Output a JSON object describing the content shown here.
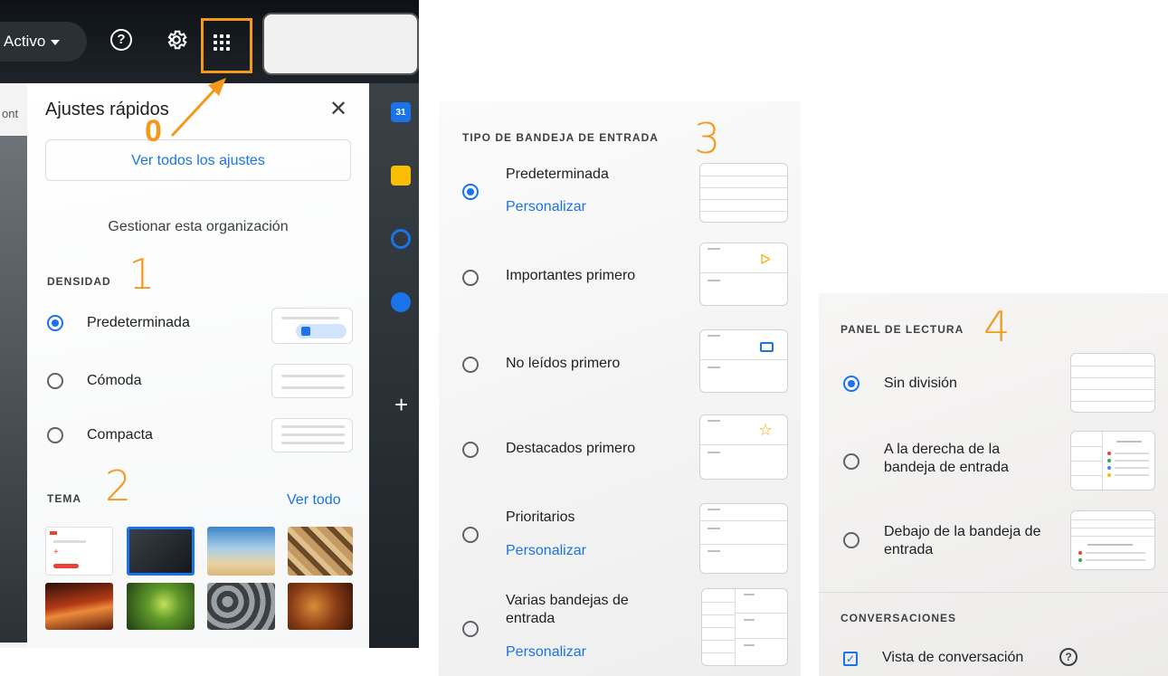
{
  "topbar": {
    "status_label": "Activo",
    "help_icon": "help-circle-icon",
    "settings_icon": "gear-icon",
    "apps_icon": "apps-grid-icon"
  },
  "annotation_color": "#f39a1c",
  "sidebar_left": {
    "partial_text": "ont"
  },
  "quick_settings": {
    "title": "Ajustes rápidos",
    "annotation_0": "0",
    "close_icon": "close-icon",
    "see_all_button": "Ver todos los ajustes",
    "manage_org": "Gestionar esta organización",
    "density": {
      "label": "DENSIDAD",
      "annotation": "1",
      "options": [
        "Predeterminada",
        "Cómoda",
        "Compacta"
      ],
      "selected": 0
    },
    "theme": {
      "label": "TEMA",
      "annotation": "2",
      "see_all": "Ver todo",
      "selected_index": 1
    }
  },
  "right_rail": {
    "calendar_label": "31",
    "icons": [
      "calendar-icon",
      "keep-icon",
      "tasks-icon",
      "contacts-icon",
      "add-icon"
    ]
  },
  "inbox_type": {
    "label": "TIPO DE BANDEJA DE ENTRADA",
    "annotation": "3",
    "options": [
      {
        "label": "Predeterminada",
        "link": "Personalizar",
        "selected": true
      },
      {
        "label": "Importantes primero",
        "icon": "important-marker-icon"
      },
      {
        "label": "No leídos primero",
        "icon": "envelope-icon"
      },
      {
        "label": "Destacados primero",
        "icon": "star-icon"
      },
      {
        "label": "Prioritarios",
        "link": "Personalizar"
      },
      {
        "label": "Varias bandejas de entrada",
        "link": "Personalizar"
      }
    ]
  },
  "reading_pane": {
    "label": "PANEL DE LECTURA",
    "annotation": "4",
    "options": [
      {
        "label": "Sin división",
        "selected": true
      },
      {
        "label": "A la derecha de la bandeja de entrada"
      },
      {
        "label": "Debajo de la bandeja de entrada"
      }
    ],
    "conversations": {
      "label": "CONVERSACIONES",
      "checkbox_label": "Vista de conversación",
      "checked": true
    }
  },
  "colors": {
    "accent_blue": "#1a73e8",
    "orange": "#f39a1c"
  }
}
